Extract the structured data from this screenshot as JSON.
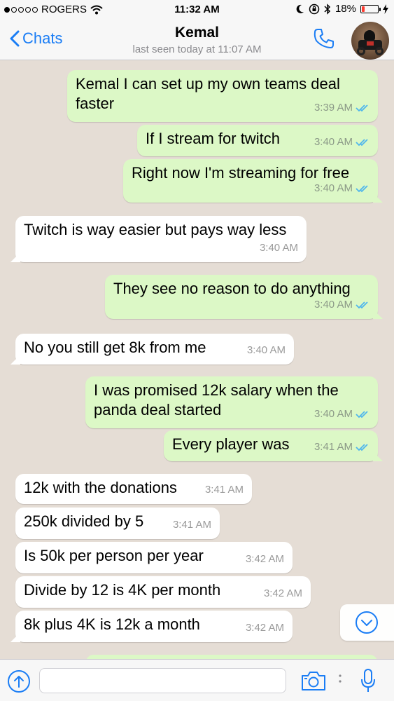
{
  "status_bar": {
    "carrier": "ROGERS",
    "time": "11:32 AM",
    "battery": "18%",
    "battery_level": 0.18
  },
  "header": {
    "back_label": "Chats",
    "contact_name": "Kemal",
    "last_seen": "last seen today at 11:07 AM"
  },
  "messages": [
    {
      "dir": "out",
      "text": "Kemal I can set up my own teams deal faster",
      "time": "3:39 AM"
    },
    {
      "dir": "out",
      "text": "If I stream for twitch",
      "time": "3:40 AM"
    },
    {
      "dir": "out",
      "text": "Right now I'm streaming for free",
      "time": "3:40 AM"
    },
    {
      "dir": "in",
      "text": "Twitch is way easier but pays way less",
      "time": "3:40 AM"
    },
    {
      "dir": "out",
      "text": "They see no reason to do anything",
      "time": "3:40 AM"
    },
    {
      "dir": "in",
      "text": "No you still get 8k from me",
      "time": "3:40 AM"
    },
    {
      "dir": "out",
      "text": "I was promised 12k salary when the panda deal started",
      "time": "3:40 AM"
    },
    {
      "dir": "out",
      "text": "Every player was",
      "time": "3:41 AM"
    },
    {
      "dir": "in",
      "text": "12k with the donations",
      "time": "3:41 AM"
    },
    {
      "dir": "in",
      "text": "250k divided by 5",
      "time": "3:41 AM"
    },
    {
      "dir": "in",
      "text": "Is 50k per person per year",
      "time": "3:42 AM"
    },
    {
      "dir": "in",
      "text": "Divide by 12 is 4K per month",
      "time": "3:42 AM"
    },
    {
      "dir": "in",
      "text": "8k plus 4K is 12k a month",
      "time": "3:42 AM"
    }
  ],
  "colors": {
    "outgoing_bubble": "#dcf8c6",
    "incoming_bubble": "#ffffff",
    "accent": "#1a7df5",
    "read_tick": "#4fb6ec"
  },
  "icons": {
    "back": "chevron-left-icon",
    "call": "phone-icon",
    "attach": "arrow-up-circle-icon",
    "camera": "camera-icon",
    "mic": "microphone-icon",
    "scroll": "chevron-down-circle-icon"
  },
  "composer": {
    "value": ""
  }
}
